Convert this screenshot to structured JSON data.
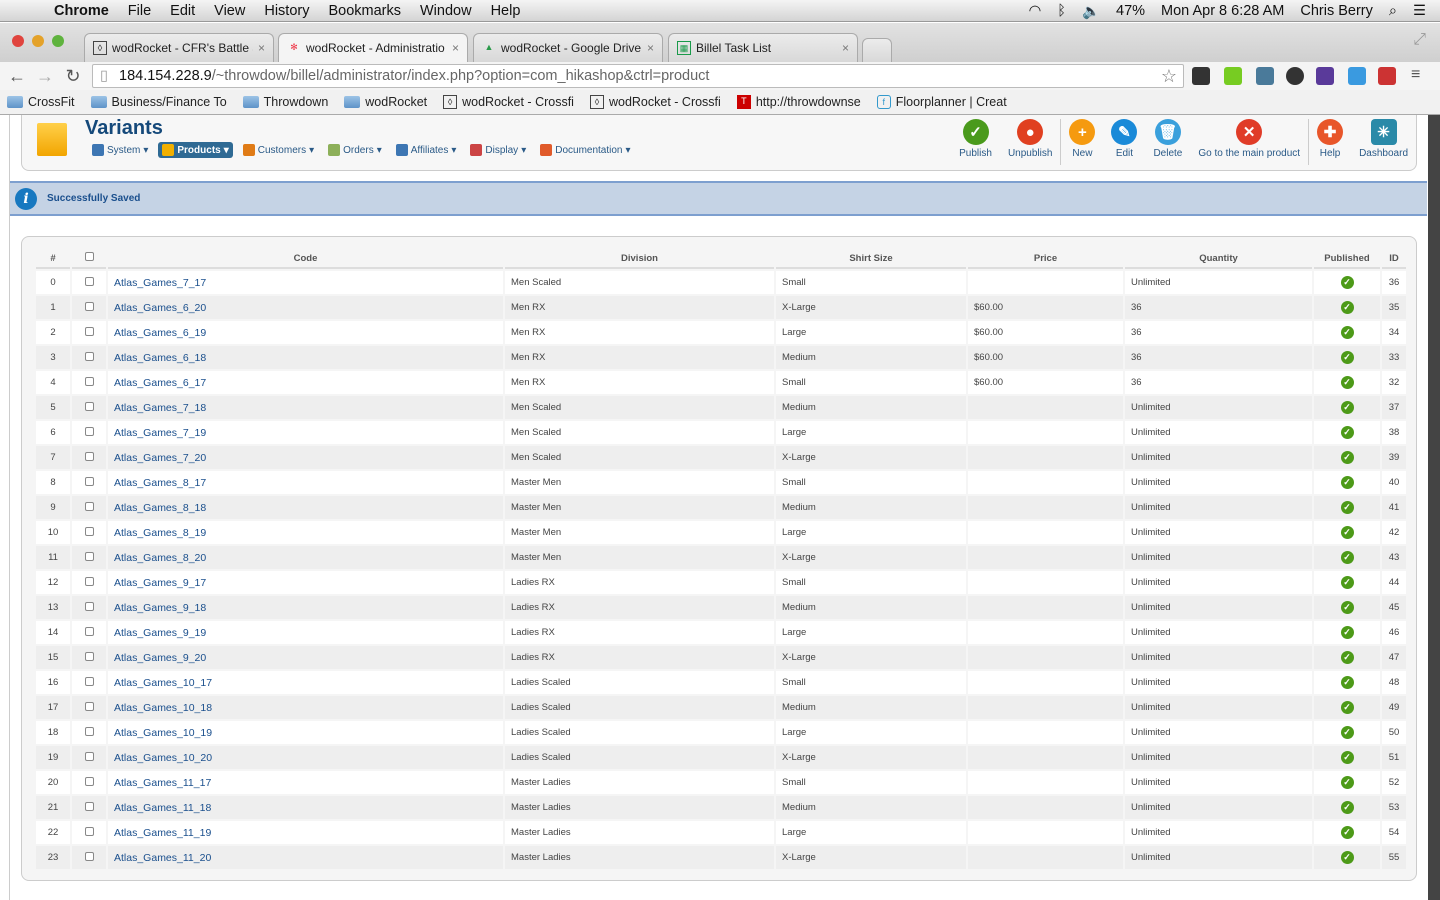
{
  "menubar": {
    "app": "Chrome",
    "items": [
      "File",
      "Edit",
      "View",
      "History",
      "Bookmarks",
      "Window",
      "Help"
    ],
    "battery": "47%",
    "datetime": "Mon Apr 8  6:28 AM",
    "user": "Chris Berry"
  },
  "tabs": [
    {
      "title": "wodRocket - CFR's Battle a"
    },
    {
      "title": "wodRocket - Administratio"
    },
    {
      "title": "wodRocket - Google Drive"
    },
    {
      "title": "Billel Task List"
    }
  ],
  "address": {
    "host": "184.154.228.9",
    "path": "/~throwdow/billel/administrator/index.php?option=com_hikashop&ctrl=product"
  },
  "bookmarks": [
    {
      "label": "CrossFit",
      "type": "folder"
    },
    {
      "label": "Business/Finance To",
      "type": "folder"
    },
    {
      "label": "Throwdown",
      "type": "folder"
    },
    {
      "label": "wodRocket",
      "type": "folder"
    },
    {
      "label": "wodRocket - Crossfi",
      "type": "page"
    },
    {
      "label": "wodRocket - Crossfi",
      "type": "page"
    },
    {
      "label": "http://throwdownse",
      "type": "ts"
    },
    {
      "label": "Floorplanner | Creat",
      "type": "fp"
    }
  ],
  "page": {
    "title": "Variants",
    "message": "Successfully Saved",
    "submenu": [
      {
        "label": "System",
        "color": "#3d76b3"
      },
      {
        "label": "Products",
        "color": "#f2b000",
        "active": true
      },
      {
        "label": "Customers",
        "color": "#e07b16"
      },
      {
        "label": "Orders",
        "color": "#8db05a"
      },
      {
        "label": "Affiliates",
        "color": "#3d76b3"
      },
      {
        "label": "Display",
        "color": "#c44"
      },
      {
        "label": "Documentation",
        "color": "#e05a2a"
      }
    ],
    "actions": [
      {
        "label": "Publish",
        "color": "#4a9a1c",
        "glyph": "✓"
      },
      {
        "label": "Unpublish",
        "color": "#e04020",
        "glyph": "●"
      },
      {
        "label": "New",
        "color": "#f59a10",
        "glyph": "+"
      },
      {
        "label": "Edit",
        "color": "#1a8ad8",
        "glyph": "✎"
      },
      {
        "label": "Delete",
        "color": "#3aa0dc",
        "glyph": "🗑"
      },
      {
        "label": "Go to the main product",
        "color": "#e03c28",
        "glyph": "✕"
      },
      {
        "label": "Help",
        "color": "#e8562a",
        "glyph": "✚"
      },
      {
        "label": "Dashboard",
        "color": "#2a8aa8",
        "glyph": "✳"
      }
    ]
  },
  "table": {
    "headers": [
      "#",
      "",
      "Code",
      "Division",
      "Shirt Size",
      "Price",
      "Quantity",
      "Published",
      "ID"
    ],
    "rows": [
      [
        "0",
        "Atlas_Games_7_17",
        "Men Scaled",
        "Small",
        "",
        "Unlimited",
        "36"
      ],
      [
        "1",
        "Atlas_Games_6_20",
        "Men RX",
        "X-Large",
        "$60.00",
        "36",
        "35"
      ],
      [
        "2",
        "Atlas_Games_6_19",
        "Men RX",
        "Large",
        "$60.00",
        "36",
        "34"
      ],
      [
        "3",
        "Atlas_Games_6_18",
        "Men RX",
        "Medium",
        "$60.00",
        "36",
        "33"
      ],
      [
        "4",
        "Atlas_Games_6_17",
        "Men RX",
        "Small",
        "$60.00",
        "36",
        "32"
      ],
      [
        "5",
        "Atlas_Games_7_18",
        "Men Scaled",
        "Medium",
        "",
        "Unlimited",
        "37"
      ],
      [
        "6",
        "Atlas_Games_7_19",
        "Men Scaled",
        "Large",
        "",
        "Unlimited",
        "38"
      ],
      [
        "7",
        "Atlas_Games_7_20",
        "Men Scaled",
        "X-Large",
        "",
        "Unlimited",
        "39"
      ],
      [
        "8",
        "Atlas_Games_8_17",
        "Master Men",
        "Small",
        "",
        "Unlimited",
        "40"
      ],
      [
        "9",
        "Atlas_Games_8_18",
        "Master Men",
        "Medium",
        "",
        "Unlimited",
        "41"
      ],
      [
        "10",
        "Atlas_Games_8_19",
        "Master Men",
        "Large",
        "",
        "Unlimited",
        "42"
      ],
      [
        "11",
        "Atlas_Games_8_20",
        "Master Men",
        "X-Large",
        "",
        "Unlimited",
        "43"
      ],
      [
        "12",
        "Atlas_Games_9_17",
        "Ladies RX",
        "Small",
        "",
        "Unlimited",
        "44"
      ],
      [
        "13",
        "Atlas_Games_9_18",
        "Ladies RX",
        "Medium",
        "",
        "Unlimited",
        "45"
      ],
      [
        "14",
        "Atlas_Games_9_19",
        "Ladies RX",
        "Large",
        "",
        "Unlimited",
        "46"
      ],
      [
        "15",
        "Atlas_Games_9_20",
        "Ladies RX",
        "X-Large",
        "",
        "Unlimited",
        "47"
      ],
      [
        "16",
        "Atlas_Games_10_17",
        "Ladies Scaled",
        "Small",
        "",
        "Unlimited",
        "48"
      ],
      [
        "17",
        "Atlas_Games_10_18",
        "Ladies Scaled",
        "Medium",
        "",
        "Unlimited",
        "49"
      ],
      [
        "18",
        "Atlas_Games_10_19",
        "Ladies Scaled",
        "Large",
        "",
        "Unlimited",
        "50"
      ],
      [
        "19",
        "Atlas_Games_10_20",
        "Ladies Scaled",
        "X-Large",
        "",
        "Unlimited",
        "51"
      ],
      [
        "20",
        "Atlas_Games_11_17",
        "Master Ladies",
        "Small",
        "",
        "Unlimited",
        "52"
      ],
      [
        "21",
        "Atlas_Games_11_18",
        "Master Ladies",
        "Medium",
        "",
        "Unlimited",
        "53"
      ],
      [
        "22",
        "Atlas_Games_11_19",
        "Master Ladies",
        "Large",
        "",
        "Unlimited",
        "54"
      ],
      [
        "23",
        "Atlas_Games_11_20",
        "Master Ladies",
        "X-Large",
        "",
        "Unlimited",
        "55"
      ]
    ]
  }
}
